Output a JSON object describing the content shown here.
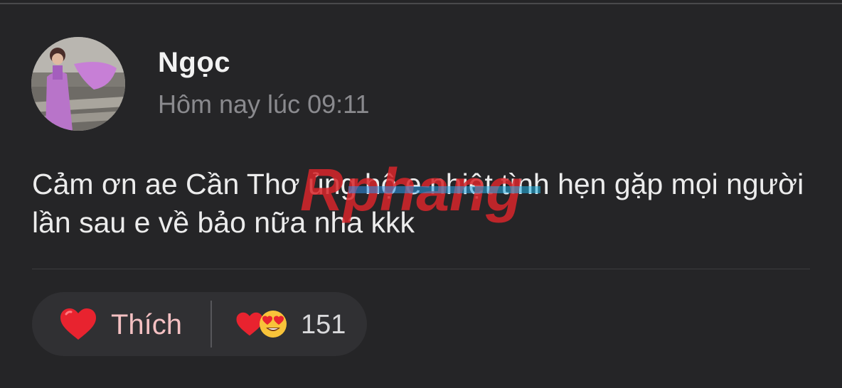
{
  "post": {
    "author": "Ngọc",
    "timestamp": "Hôm nay lúc 09:11",
    "text": "Cảm ơn ae Cần Thơ ủng hộ e nhiệt tình hẹn gặp mọi người lần sau e về bảo nữa nha kkk"
  },
  "watermark": {
    "text": "Rphang"
  },
  "reactions": {
    "like_label": "Thích",
    "like_icon": "heart-icon",
    "summary_icons": [
      "heart-icon",
      "heart-eyes-emoji-icon"
    ],
    "count": "151"
  },
  "colors": {
    "background": "#252527",
    "pill": "#303033",
    "heart": "#e8232f",
    "like_text": "#f4c0c2",
    "timestamp": "#8a8a8e"
  }
}
